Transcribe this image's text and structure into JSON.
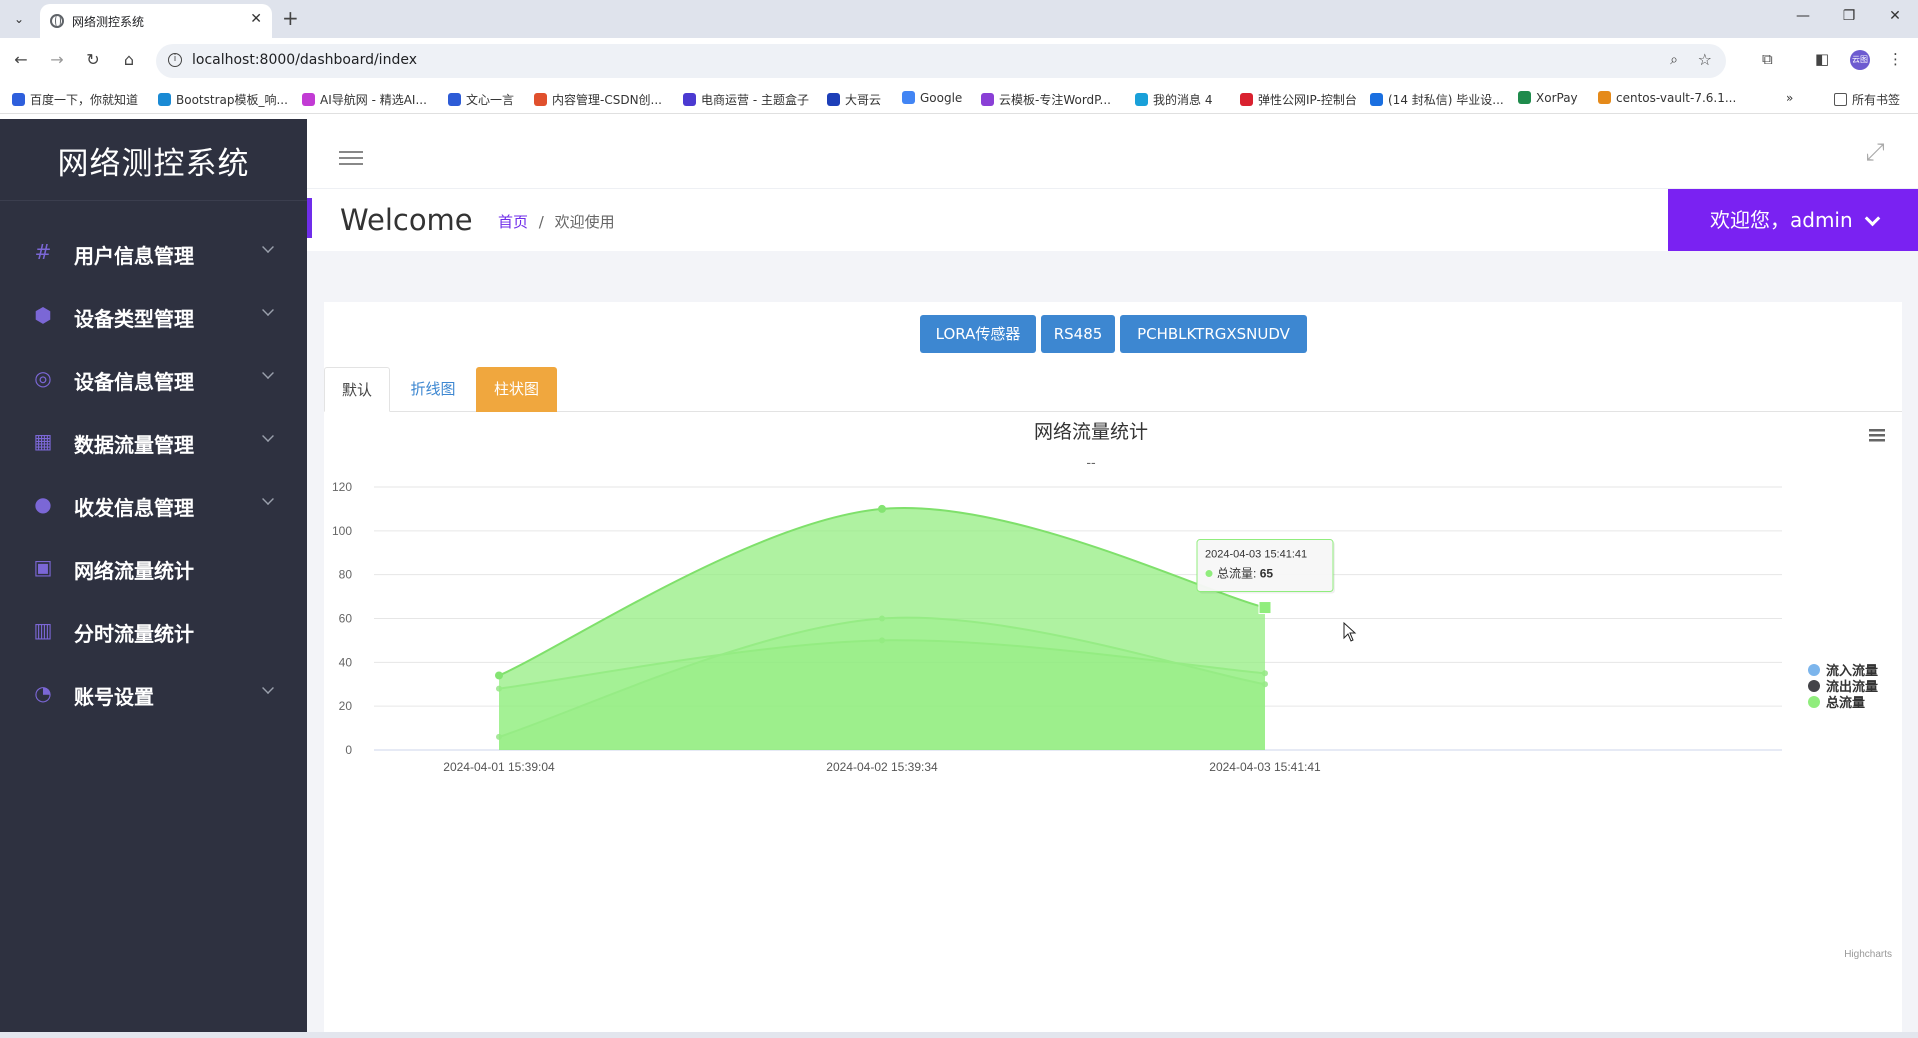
{
  "browser": {
    "tab_title": "网络测控系统",
    "url": "localhost:8000/dashboard/index",
    "bookmarks": [
      {
        "label": "百度一下，你就知道",
        "color": "#2e5fdc"
      },
      {
        "label": "Bootstrap模板_响...",
        "color": "#1a8ad4"
      },
      {
        "label": "AI导航网 - 精选AI...",
        "color": "#c23bd4"
      },
      {
        "label": "文心一言",
        "color": "#2d5bd6"
      },
      {
        "label": "内容管理-CSDN创...",
        "color": "#e0502d"
      },
      {
        "label": "电商运营 - 主题盒子",
        "color": "#4b3ad1"
      },
      {
        "label": "大哥云",
        "color": "#1d3fb8"
      },
      {
        "label": "Google",
        "color": "#4285f4"
      },
      {
        "label": "云模板-专注WordP...",
        "color": "#8a3fd6"
      },
      {
        "label": "我的消息 4",
        "color": "#19a0d9"
      },
      {
        "label": "弹性公网IP-控制台",
        "color": "#d9212f"
      },
      {
        "label": "(14 封私信) 毕业设...",
        "color": "#1a6fe0"
      },
      {
        "label": "XorPay",
        "color": "#1f8b4c"
      },
      {
        "label": "centos-vault-7.6.1...",
        "color": "#e58a1a"
      }
    ],
    "all_bookmarks": "所有书签",
    "profile_initials": "云图"
  },
  "app": {
    "brand": "网络测控系统",
    "menu": [
      {
        "label": "用户信息管理",
        "icon": "#",
        "has_children": true
      },
      {
        "label": "设备类型管理",
        "icon": "⬢",
        "has_children": true
      },
      {
        "label": "设备信息管理",
        "icon": "◎",
        "has_children": true
      },
      {
        "label": "数据流量管理",
        "icon": "▦",
        "has_children": true
      },
      {
        "label": "收发信息管理",
        "icon": "●",
        "has_children": true
      },
      {
        "label": "网络流量统计",
        "icon": "▣",
        "has_children": false
      },
      {
        "label": "分时流量统计",
        "icon": "▥",
        "has_children": false
      },
      {
        "label": "账号设置",
        "icon": "◔",
        "has_children": true
      }
    ],
    "welcome_title": "Welcome",
    "breadcrumb_home": "首页",
    "breadcrumb_sep": "/",
    "breadcrumb_current": "欢迎使用",
    "user_greeting": "欢迎您，admin",
    "device_buttons": [
      "LORA传感器",
      "RS485",
      "PCHBLKTRGXSNUDV"
    ],
    "chart_tabs": [
      "默认",
      "折线图",
      "柱状图"
    ],
    "active_tab": "柱状图"
  },
  "chart_data": {
    "type": "area",
    "title": "网络流量统计",
    "subtitle": "--",
    "x": [
      "2024-04-01 15:39:04",
      "2024-04-02 15:39:34",
      "2024-04-03 15:41:41"
    ],
    "ylim": [
      0,
      120
    ],
    "yticks": [
      0,
      20,
      40,
      60,
      80,
      100,
      120
    ],
    "grid": true,
    "legend_position": "right",
    "series": [
      {
        "name": "流入流量",
        "values": [
          28,
          50,
          35
        ],
        "color": "#7cb5ec"
      },
      {
        "name": "流出流量",
        "values": [
          6,
          60,
          30
        ],
        "color": "#434348"
      },
      {
        "name": "总流量",
        "values": [
          34,
          110,
          65
        ],
        "color": "#90ed7d"
      }
    ],
    "tooltip": {
      "x_label": "2024-04-03 15:41:41",
      "series_name": "总流量",
      "value": "65"
    },
    "credits": "Highcharts"
  }
}
